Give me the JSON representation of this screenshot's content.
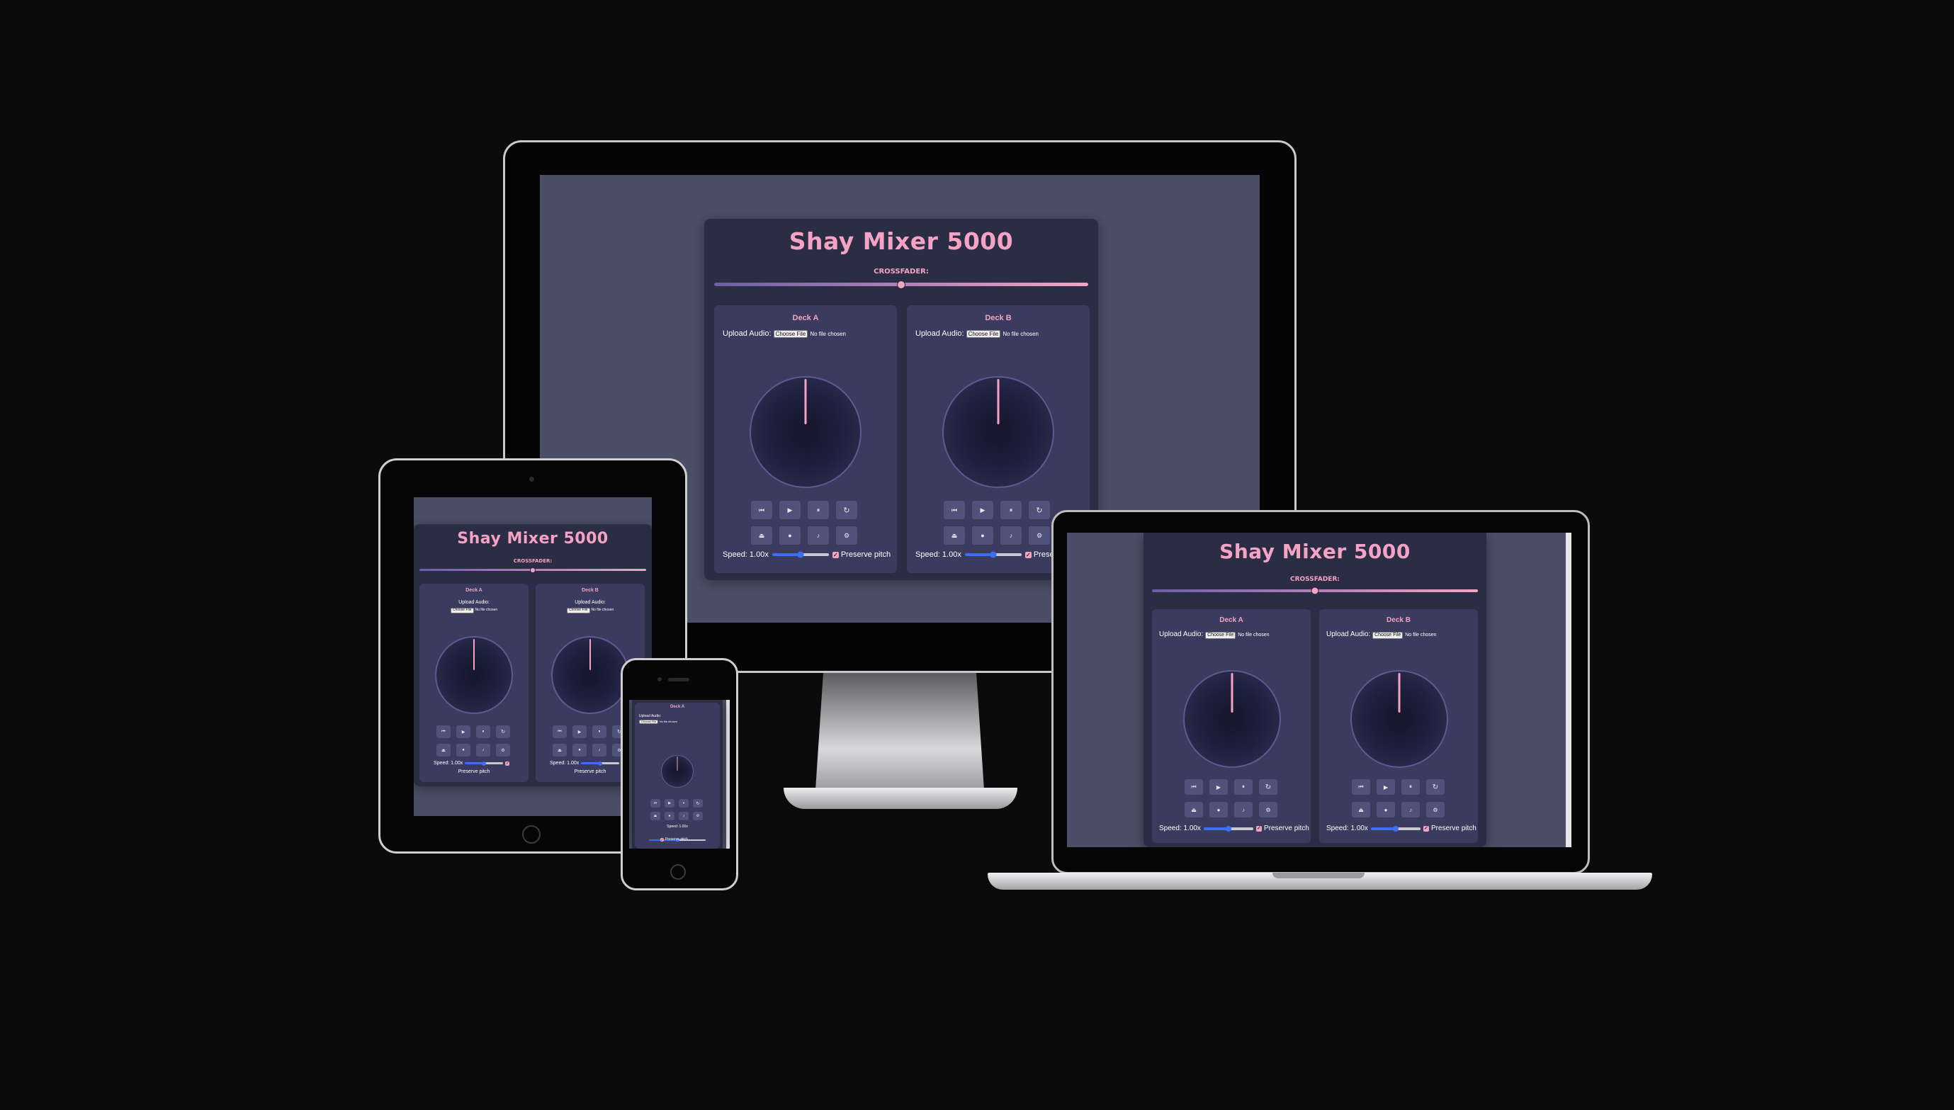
{
  "app": {
    "title": "Shay Mixer 5000",
    "crossfader_label": "CROSSFADER:",
    "decks": [
      {
        "title": "Deck A",
        "upload_label": "Upload Audio:",
        "file_button": "Choose File",
        "file_status": "No file chosen",
        "speed_label": "Speed: 1.00x",
        "preserve_label": "Preserve pitch"
      },
      {
        "title": "Deck B",
        "upload_label": "Upload Audio:",
        "file_button": "Choose File",
        "file_status": "No file chosen",
        "speed_label": "Speed: 1.00x",
        "preserve_label": "Preserve pitch"
      }
    ],
    "controls": {
      "row1": [
        "skip-back-icon",
        "play-icon",
        "pause-icon",
        "loop-icon"
      ],
      "row2": [
        "eject-icon",
        "record-icon",
        "volume-icon",
        "settings-icon"
      ]
    },
    "crossfader_position": 0.5,
    "speed_value": 1.0
  },
  "colors": {
    "page_bg": "#0b0b0c",
    "screen_bg": "#4b4e66",
    "app_bg": "#2b2d45",
    "deck_bg": "#3a3b5e",
    "accent": "#f4a3c4",
    "slider": "#3d6ef5"
  }
}
